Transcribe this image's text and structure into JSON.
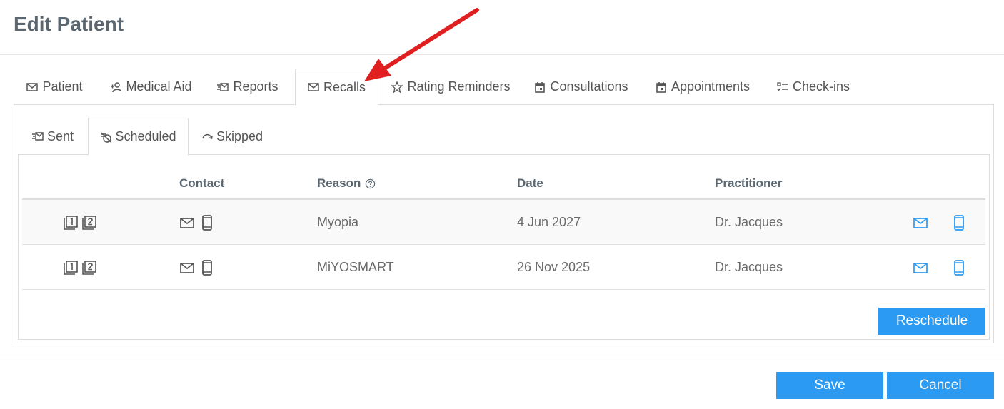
{
  "page": {
    "title": "Edit Patient"
  },
  "main_tabs": [
    {
      "label": "Patient",
      "icon": "mail-icon"
    },
    {
      "label": "Medical Aid",
      "icon": "add-person-icon"
    },
    {
      "label": "Reports",
      "icon": "reports-icon"
    },
    {
      "label": "Recalls",
      "icon": "mail-icon"
    },
    {
      "label": "Rating Reminders",
      "icon": "star-icon"
    },
    {
      "label": "Consultations",
      "icon": "calendar-icon"
    },
    {
      "label": "Appointments",
      "icon": "calendar-icon"
    },
    {
      "label": "Check-ins",
      "icon": "checklist-icon"
    }
  ],
  "main_tabs_active": "Recalls",
  "sub_tabs": [
    {
      "label": "Sent",
      "icon": "send-mail-icon"
    },
    {
      "label": "Scheduled",
      "icon": "scheduled-icon"
    },
    {
      "label": "Skipped",
      "icon": "skip-icon"
    }
  ],
  "sub_tabs_active": "Scheduled",
  "table": {
    "columns": {
      "contact": "Contact",
      "reason": "Reason",
      "date": "Date",
      "practitioner": "Practitioner"
    },
    "rows": [
      {
        "reason": "Myopia",
        "date": "4 Jun 2027",
        "practitioner": "Dr. Jacques"
      },
      {
        "reason": "MiYOSMART",
        "date": "26 Nov 2025",
        "practitioner": "Dr. Jacques"
      }
    ]
  },
  "buttons": {
    "reschedule": "Reschedule",
    "save": "Save",
    "cancel": "Cancel"
  },
  "colors": {
    "accent": "#2b9af3",
    "annotation_arrow": "#e02020",
    "title": "#5b6770"
  }
}
